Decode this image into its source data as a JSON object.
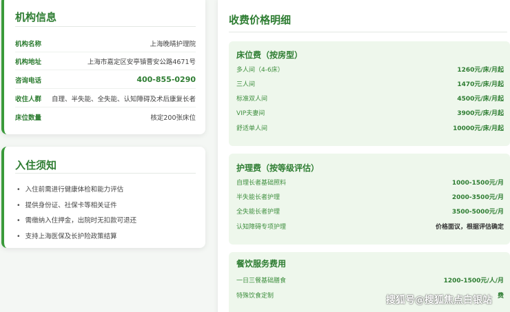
{
  "info_card": {
    "title": "机构信息",
    "rows": [
      {
        "label": "机构名称",
        "value": "上海晚晴护理院"
      },
      {
        "label": "机构地址",
        "value": "上海市嘉定区安亭镇曹安公路4671号"
      },
      {
        "label": "咨询电话",
        "value": "400-855-0290"
      },
      {
        "label": "收住人群",
        "value": "自理、半失能、全失能、认知障碍及术后康复长者"
      },
      {
        "label": "床位数量",
        "value": "核定200张床位"
      }
    ]
  },
  "notice_card": {
    "title": "入住须知",
    "items": [
      "入住前需进行健康体检和能力评估",
      "提供身份证、社保卡等相关证件",
      "需缴纳入住押金，出院时无扣款可退还",
      "支持上海医保及长护险政策结算"
    ]
  },
  "price_card": {
    "title": "收费价格明细",
    "sections": [
      {
        "title": "床位费（按房型）",
        "rows": [
          {
            "name": "多人间（4-6床）",
            "price": "1260元/床/月起"
          },
          {
            "name": "三人间",
            "price": "1470元/床/月起"
          },
          {
            "name": "标准双人间",
            "price": "4500元/床/月起"
          },
          {
            "name": "VIP夫妻间",
            "price": "3900元/床/月起"
          },
          {
            "name": "舒适单人间",
            "price": "10000元/床/月起"
          }
        ]
      },
      {
        "title": "护理费（按等级评估）",
        "rows": [
          {
            "name": "自理长者基础照料",
            "price": "1000-1500元/月"
          },
          {
            "name": "半失能长者护理",
            "price": "2000-3500元/月"
          },
          {
            "name": "全失能长者护理",
            "price": "3500-5000元/月"
          },
          {
            "name": "认知障碍专项护理",
            "price": "价格面议，根据评估确定"
          }
        ]
      },
      {
        "title": "餐饮服务费用",
        "rows": [
          {
            "name": "一日三餐基础膳食",
            "price": "1200-1500元/人/月"
          },
          {
            "name": "特殊饮食定制",
            "price": "费"
          }
        ]
      }
    ]
  },
  "watermark": "搜狐号@搜狐焦点白银站",
  "colors": {
    "accent": "#2e7d32",
    "section_bg": "#eef7ec",
    "page_bg": "#f4f7f4"
  }
}
